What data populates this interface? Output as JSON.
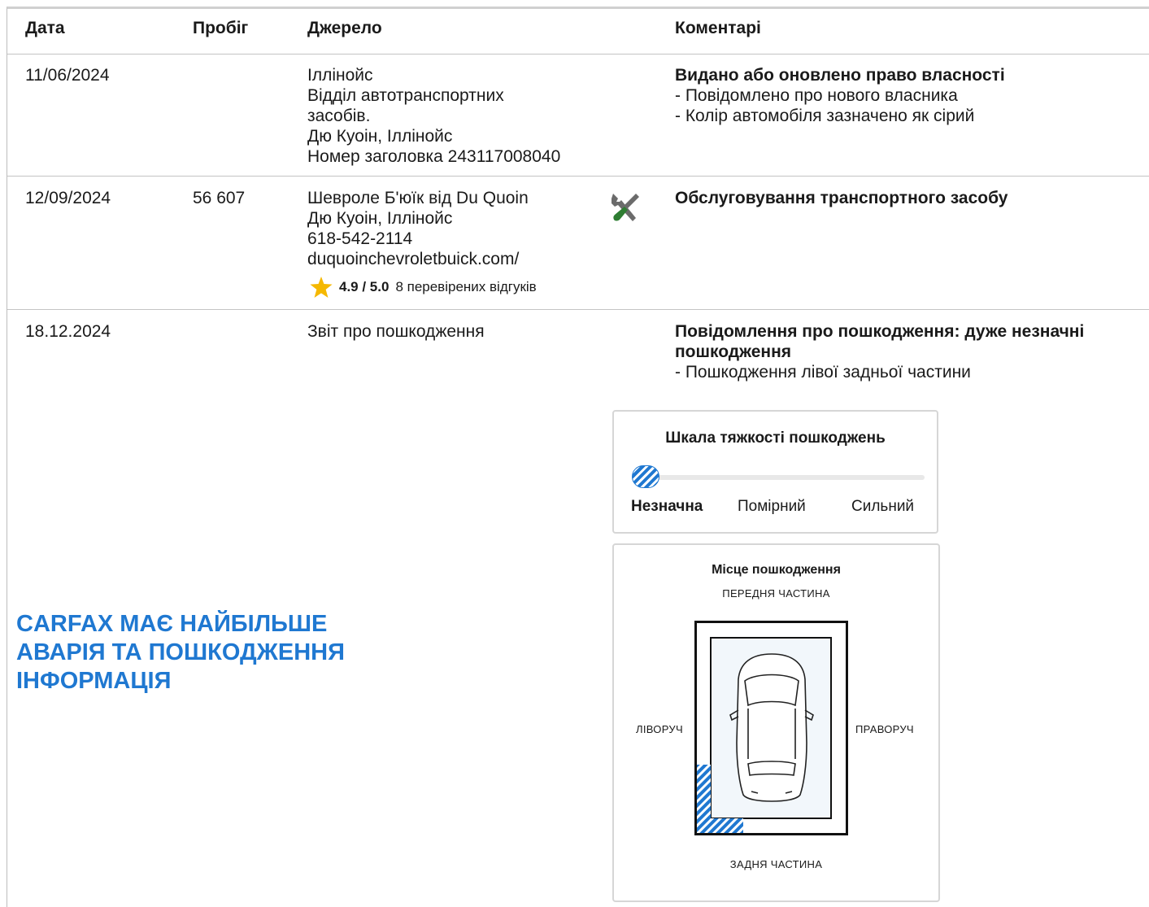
{
  "headers": {
    "date": "Дата",
    "mileage": "Пробіг",
    "source": "Джерело",
    "comments": "Коментарі"
  },
  "rows": [
    {
      "date": "11/06/2024",
      "mileage": "",
      "source_lines": [
        "Іллінойс",
        "Відділ автотранспортних",
        "засобів.",
        "Дю Куоін, Іллінойс",
        "Номер заголовка 243117008040"
      ],
      "comment_title": "Видано або оновлено право власності",
      "comment_lines": [
        "- Повідомлено про нового власника",
        "- Колір автомобіля зазначено як сірий"
      ]
    },
    {
      "date": "12/09/2024",
      "mileage": "56 607",
      "source_lines": [
        "Шевроле Б'юїк від Du Quoin",
        "Дю Куоін, Іллінойс",
        "618-542-2114",
        "duquoinchevroletbuick.com/"
      ],
      "rating_score": "4.9 / 5.0",
      "rating_reviews": "8 перевірених відгуків",
      "icon": "service-tools-icon",
      "comment_title": "Обслуговування транспортного засобу",
      "comment_lines": []
    },
    {
      "date": "18.12.2024",
      "mileage": "",
      "source_lines": [
        "Звіт про пошкодження"
      ],
      "comment_title_lines": [
        "Повідомлення про пошкодження: дуже незначні",
        "пошкодження"
      ],
      "comment_lines": [
        "- Пошкодження лівої задньої частини"
      ]
    }
  ],
  "promo_lines": [
    "CARFAX МАЄ НАЙБІЛЬШЕ",
    "АВАРІЯ ТА ПОШКОДЖЕННЯ",
    "ІНФОРМАЦІЯ"
  ],
  "severity": {
    "title": "Шкала тяжкості пошкоджень",
    "labels": [
      "Незначна",
      "Помірний",
      "Сильний"
    ],
    "selected": "Незначна"
  },
  "damage_location": {
    "title": "Місце пошкодження",
    "front": "ПЕРЕДНЯ ЧАСТИНА",
    "rear": "ЗАДНЯ ЧАСТИНА",
    "left": "ЛІВОРУЧ",
    "right": "ПРАВОРУЧ",
    "damaged_area": "left-rear"
  },
  "colors": {
    "accent": "#1f78d1",
    "star": "#f5b800",
    "tool_handle": "#2e7d32"
  }
}
